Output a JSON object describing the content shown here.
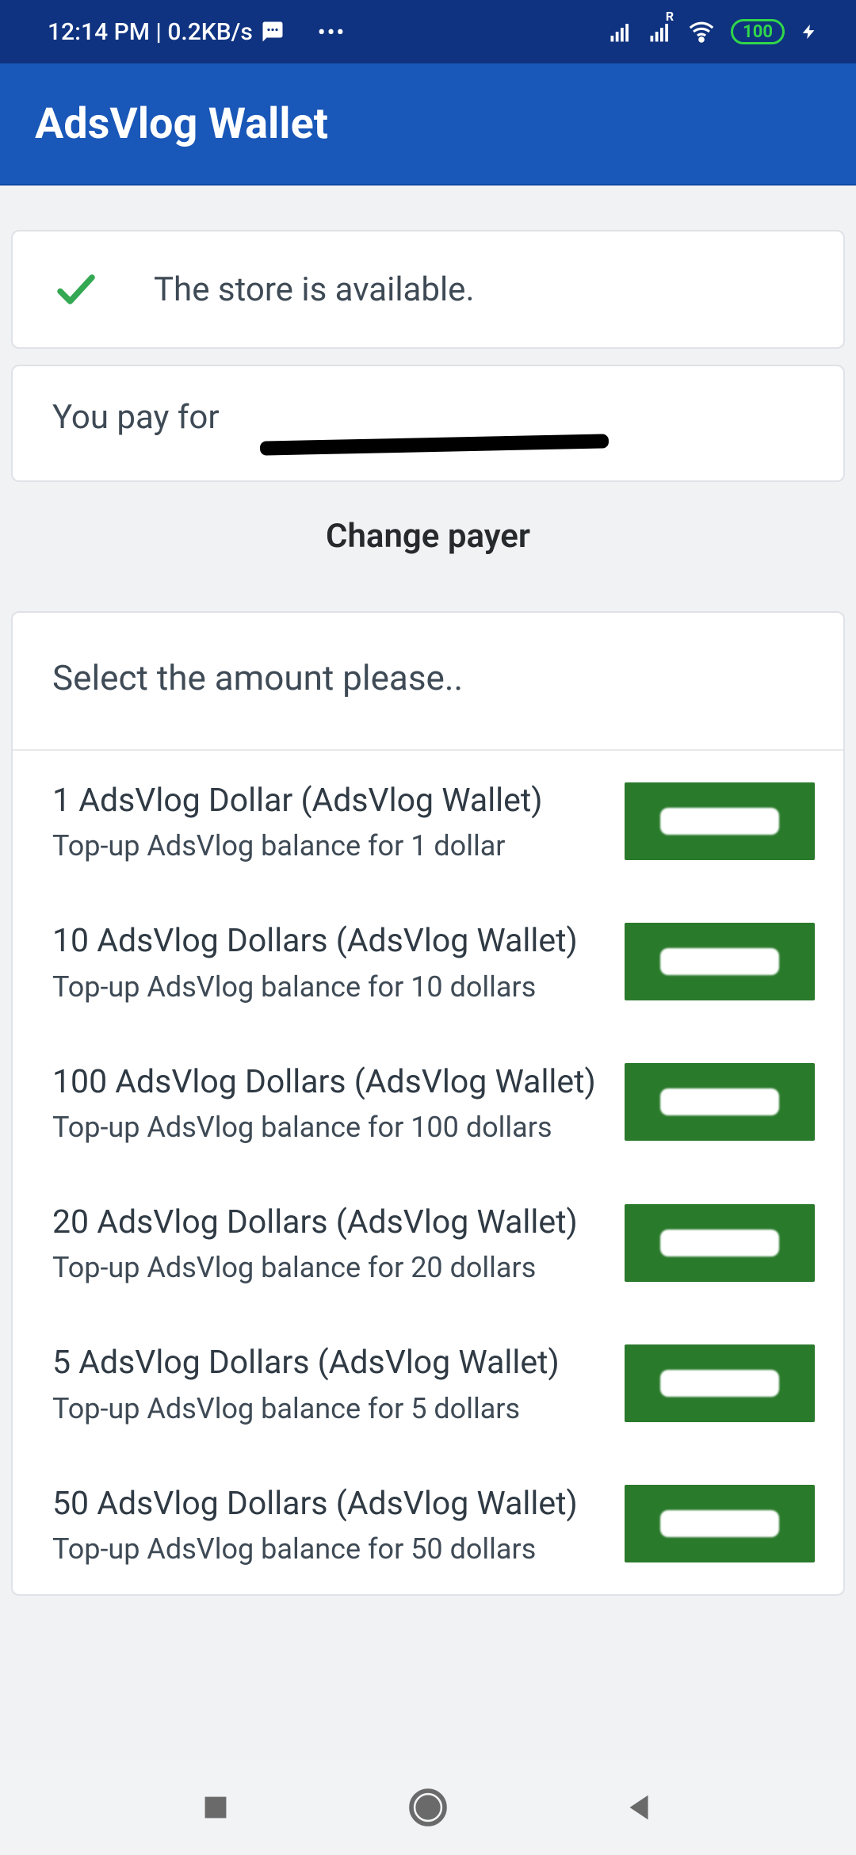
{
  "statusbar": {
    "time_and_speed": "12:14 PM | 0.2KB/s",
    "sim_label_r": "R",
    "battery": "100"
  },
  "appbar": {
    "title": "AdsVlog Wallet"
  },
  "store_status": {
    "text": "The store is available."
  },
  "payer": {
    "label": "You pay for",
    "change_payer": "Change payer"
  },
  "amount_header": "Select the amount please..",
  "items": [
    {
      "title": "1 AdsVlog Dollar (AdsVlog Wallet)",
      "subtitle": "Top-up AdsVlog balance for 1 dollar"
    },
    {
      "title": "10 AdsVlog Dollars (AdsVlog Wallet)",
      "subtitle": "Top-up AdsVlog balance for 10 dollars"
    },
    {
      "title": "100 AdsVlog Dollars (AdsVlog Wallet)",
      "subtitle": "Top-up AdsVlog balance for 100 dollars"
    },
    {
      "title": "20 AdsVlog Dollars (AdsVlog Wallet)",
      "subtitle": "Top-up AdsVlog balance for 20 dollars"
    },
    {
      "title": "5 AdsVlog Dollars (AdsVlog Wallet)",
      "subtitle": "Top-up AdsVlog balance for 5 dollars"
    },
    {
      "title": "50 AdsVlog Dollars (AdsVlog Wallet)",
      "subtitle": "Top-up AdsVlog balance for 50 dollars"
    }
  ]
}
